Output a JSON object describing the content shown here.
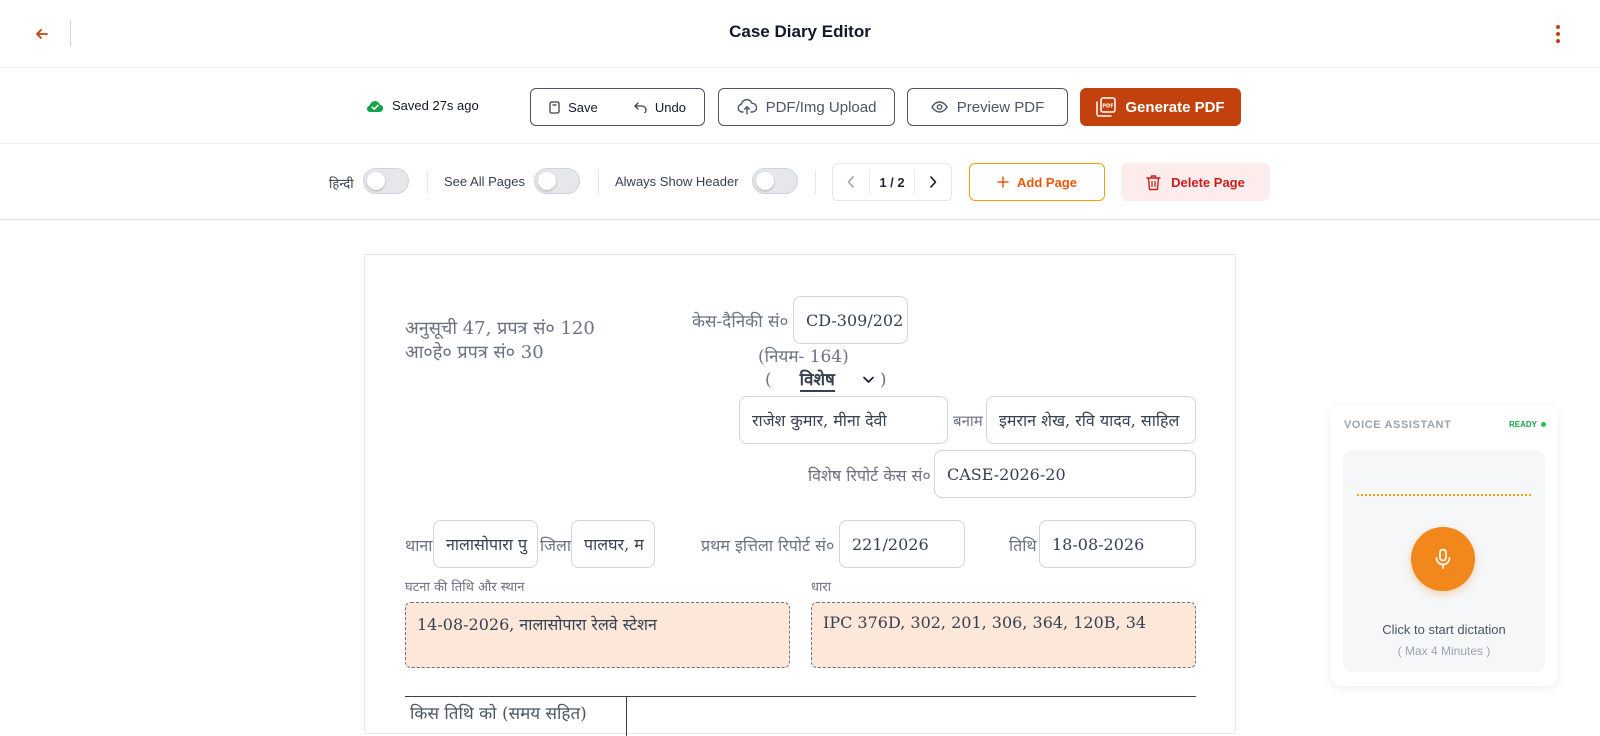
{
  "header": {
    "title": "Case Diary Editor"
  },
  "toolbar": {
    "saved_status": "Saved 27s ago",
    "save_label": "Save",
    "undo_label": "Undo",
    "upload_label": "PDF/Img Upload",
    "preview_label": "Preview PDF",
    "generate_label": "Generate PDF"
  },
  "options": {
    "hindi_label": "हिन्दी",
    "see_all_pages_label": "See All Pages",
    "always_show_header_label": "Always Show Header",
    "page_indicator": "1 / 2",
    "add_page_label": "Add Page",
    "delete_page_label": "Delete Page"
  },
  "document": {
    "schedule_line1": "अनुसूची 47, प्रपत्र सं० 120",
    "schedule_line2": "आ०हे० प्रपत्र सं० 30",
    "case_diary_label": "केस-दैनिकी सं०",
    "case_diary_value": "CD-309/202",
    "rule_text": "(नियम- 164)",
    "paren_open": "(",
    "paren_close": ")",
    "type_value": "विशेष",
    "complainant_value": "राजेश कुमार, मीना देवी",
    "versus_label": "बनाम",
    "accused_value": "इमरान शेख, रवि यादव, साहिल",
    "special_report_label": "विशेष रिपोर्ट केस सं०",
    "special_report_value": "CASE-2026-20",
    "thana_label": "थाना",
    "thana_value": "नालासोपारा पु",
    "district_label": "जिला",
    "district_value": "पालघर, म",
    "fir_label": "प्रथम इत्तिला रिपोर्ट सं०",
    "fir_value": "221/2026",
    "date_label": "तिथि",
    "date_value": "18-08-2026",
    "incident_label": "घटना की तिथि और स्थान",
    "incident_value": "14-08-2026, नालासोपारा रेलवे स्टेशन",
    "section_label": "धारा",
    "section_value": "IPC 376D, 302, 201, 306, 364, 120B, 34",
    "table_header": "किस तिथि को (समय सहित)"
  },
  "voice_assistant": {
    "title": "VOICE ASSISTANT",
    "status": "READY",
    "cta": "Click to start dictation",
    "max": "( Max 4 Minutes )"
  },
  "colors": {
    "accent": "#c2410c",
    "highlight_field": "#fde7d8",
    "mic": "#f2871c",
    "ready": "#16a34a",
    "danger": "#c81e1e"
  }
}
